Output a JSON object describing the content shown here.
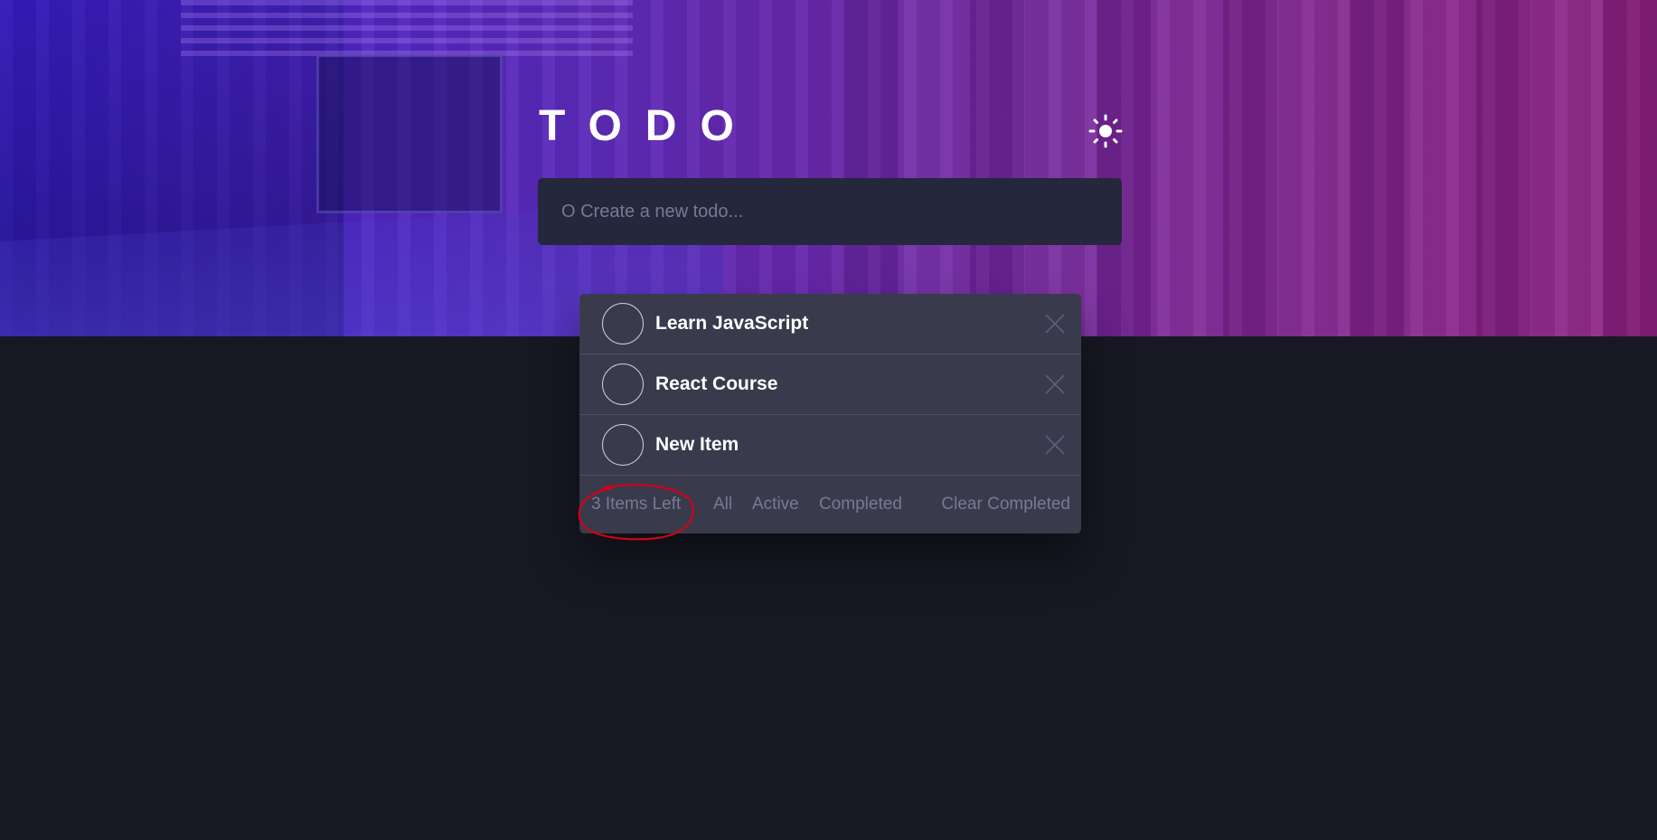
{
  "app": {
    "title": "TODO"
  },
  "new_todo": {
    "placeholder": "O Create a new todo..."
  },
  "todos": [
    {
      "text": "Learn JavaScript"
    },
    {
      "text": "React Course"
    },
    {
      "text": "New Item"
    }
  ],
  "footer": {
    "items_left": "3 Items Left",
    "filters": {
      "all": "All",
      "active": "Active",
      "completed": "Completed"
    },
    "clear_completed": "Clear Completed"
  },
  "icons": {
    "theme_toggle": "sun-icon",
    "delete": "cross-icon"
  },
  "colors": {
    "background": "#171823",
    "input_bg": "#25273d",
    "list_bg": "#393a4b",
    "muted_text": "#777a92",
    "annotation": "#d0021b"
  }
}
